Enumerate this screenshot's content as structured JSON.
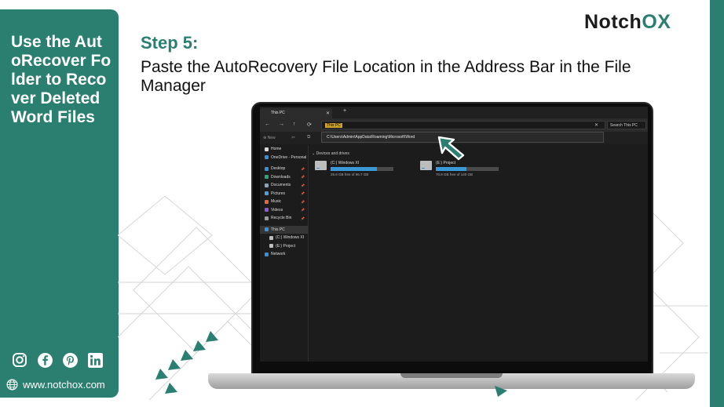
{
  "sidebar": {
    "title": "Use the AutoRecover Folder to Recover Deleted Word Files",
    "website": "www.notchox.com",
    "social_icons": [
      "instagram-icon",
      "facebook-icon",
      "pinterest-icon",
      "linkedin-icon"
    ]
  },
  "header": {
    "logo_main": "Notch",
    "logo_x": "OX",
    "step": "Step 5:",
    "description": "Paste the AutoRecovery File Location in the Address Bar in the File Manager"
  },
  "explorer": {
    "tab_title": "This PC",
    "tab_close": "✕",
    "tab_add": "+",
    "nav": {
      "back": "←",
      "forward": "→",
      "up": "↑",
      "refresh": "⟳"
    },
    "address_selected": "This PC",
    "address_close": "✕",
    "search_placeholder": "Search This PC",
    "new_label": "New",
    "dropdown_path": "C:\\Users\\Admin\\AppData\\Roaming\\Microsoft\\Word",
    "nav_pane": [
      {
        "label": "Home",
        "color": "#d8d8d8",
        "pinned": false
      },
      {
        "label": "OneDrive - Personal",
        "color": "#3a8fd9",
        "pinned": false
      },
      {
        "label": "Desktop",
        "color": "#3a8fd9",
        "pinned": true
      },
      {
        "label": "Downloads",
        "color": "#2fa37f",
        "pinned": true
      },
      {
        "label": "Documents",
        "color": "#8fa4b8",
        "pinned": true
      },
      {
        "label": "Pictures",
        "color": "#4fa0d9",
        "pinned": true
      },
      {
        "label": "Music",
        "color": "#e06a3a",
        "pinned": true
      },
      {
        "label": "Videos",
        "color": "#8a5cd0",
        "pinned": true
      },
      {
        "label": "Recycle Bin",
        "color": "#9a9a9a",
        "pinned": true
      },
      {
        "label": "This PC",
        "color": "#3a8fd9",
        "pinned": false,
        "selected": true
      },
      {
        "label": "(C:) Windows XI",
        "color": "#bdbdbd",
        "pinned": false,
        "indent": true
      },
      {
        "label": "(E:) Project",
        "color": "#bdbdbd",
        "pinned": false,
        "indent": true
      },
      {
        "label": "Network",
        "color": "#3a8fd9",
        "pinned": false
      }
    ],
    "pin_glyph": "📌",
    "group_heading": "Devices and drives",
    "drives": [
      {
        "name": "(C:) Windows XI",
        "free": "25.6 GB free of 96.7 GB",
        "used_fraction": 0.74
      },
      {
        "name": "(E:) Project",
        "free": "70.8 GB free of 140 GB",
        "used_fraction": 0.49
      }
    ]
  },
  "colors": {
    "teal": "#2b7f71",
    "highlight": "#c9a227"
  }
}
